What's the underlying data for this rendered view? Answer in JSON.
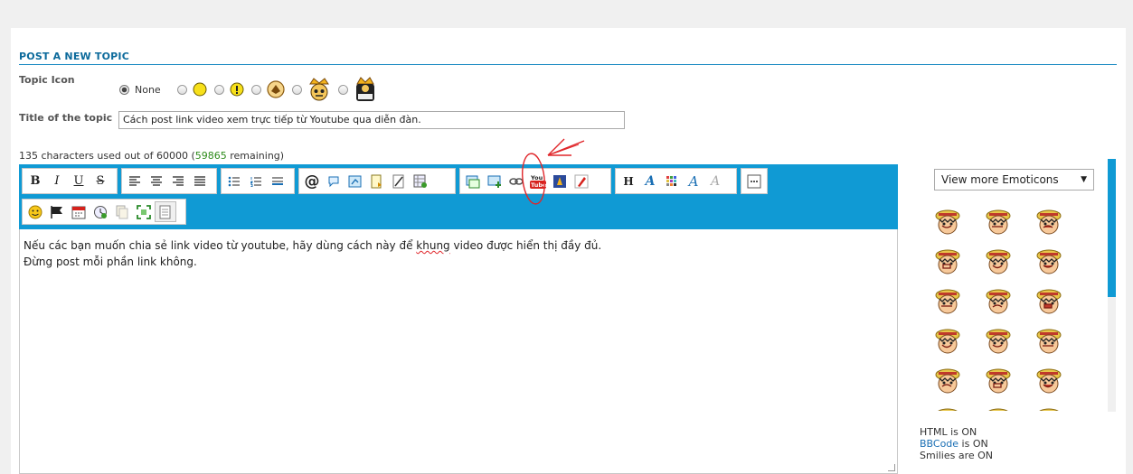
{
  "section": {
    "title": "POST A NEW TOPIC"
  },
  "topic_icon": {
    "label": "Topic Icon",
    "options": [
      {
        "label": "None",
        "selected": true,
        "icon": "none"
      },
      {
        "label": "",
        "selected": false,
        "icon": "yellow-smiley-icon"
      },
      {
        "label": "",
        "selected": false,
        "icon": "exclamation-icon"
      },
      {
        "label": "",
        "selected": false,
        "icon": "gold-badge-icon"
      },
      {
        "label": "",
        "selected": false,
        "icon": "crowned-skull-icon"
      },
      {
        "label": "",
        "selected": false,
        "icon": "1000-sunny-icon"
      }
    ]
  },
  "title_field": {
    "label": "Title of the topic",
    "value": "Cách post link video xem trực tiếp từ Youtube qua diễn đàn."
  },
  "counter": {
    "prefix": "135 characters used out of 60000 (",
    "remaining": "59865",
    "suffix": " remaining)"
  },
  "toolbar": {
    "color": "#109ad4",
    "buttons_row1": [
      "bold",
      "italic",
      "underline",
      "strikethrough",
      "align-left",
      "align-center",
      "align-right",
      "justify",
      "bulleted-list",
      "numbered-list",
      "horizontal-rule",
      "at-mention",
      "speech-bubble",
      "share",
      "spoiler",
      "hide",
      "table",
      "insert-image",
      "upload-image",
      "link",
      "youtube",
      "flash",
      "dailymotion",
      "heading",
      "font",
      "color-palette",
      "font-face",
      "clear-format",
      "more"
    ],
    "buttons_row2": [
      "emoticon",
      "flag",
      "date",
      "time",
      "copy",
      "fullscreen",
      "source-view"
    ]
  },
  "editor": {
    "line1_before": "Nếu các bạn muốn chia sẻ link video từ youtube, hãy dùng cách này để ",
    "line1_misspelled": "khung",
    "line1_after": " video được hiển thị đầy đủ.",
    "line2": "Đừng post mỗi phần link không."
  },
  "emoticons": {
    "select_label": "View more Emoticons",
    "count": 18
  },
  "status": {
    "html": "HTML is ON",
    "bbcode_link": "BBCode",
    "bbcode_suffix": " is ON",
    "smilies": "Smilies are ON"
  }
}
